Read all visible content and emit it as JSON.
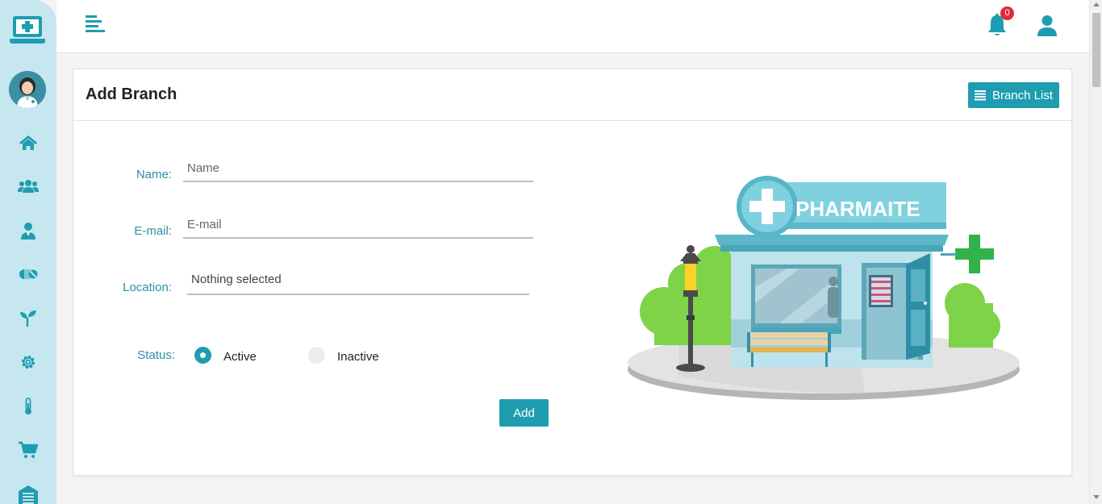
{
  "topbar": {
    "notification_count": "0"
  },
  "card": {
    "title": "Add Branch",
    "branch_list_label": "Branch List"
  },
  "form": {
    "name_label": "Name:",
    "name_placeholder": "Name",
    "email_label": "E-mail:",
    "email_placeholder": "E-mail",
    "location_label": "Location:",
    "location_value": "Nothing selected",
    "status_label": "Status:",
    "status_options": [
      {
        "label": "Active",
        "checked": true
      },
      {
        "label": "Inactive",
        "checked": false
      }
    ],
    "submit_label": "Add"
  },
  "illustration": {
    "sign_text": "PHARMAITE"
  },
  "sidebar": {
    "items": [
      {
        "icon": "home-icon"
      },
      {
        "icon": "users-icon"
      },
      {
        "icon": "doctor-icon"
      },
      {
        "icon": "pills-icon"
      },
      {
        "icon": "seedling-icon"
      },
      {
        "icon": "gear-icon"
      },
      {
        "icon": "thermometer-icon"
      },
      {
        "icon": "cart-icon"
      },
      {
        "icon": "warehouse-icon"
      }
    ]
  },
  "colors": {
    "accent": "#1e9db1",
    "sidebar_bg": "#c6e7ef",
    "label": "#2a8fa4",
    "badge": "#e02a3a"
  }
}
